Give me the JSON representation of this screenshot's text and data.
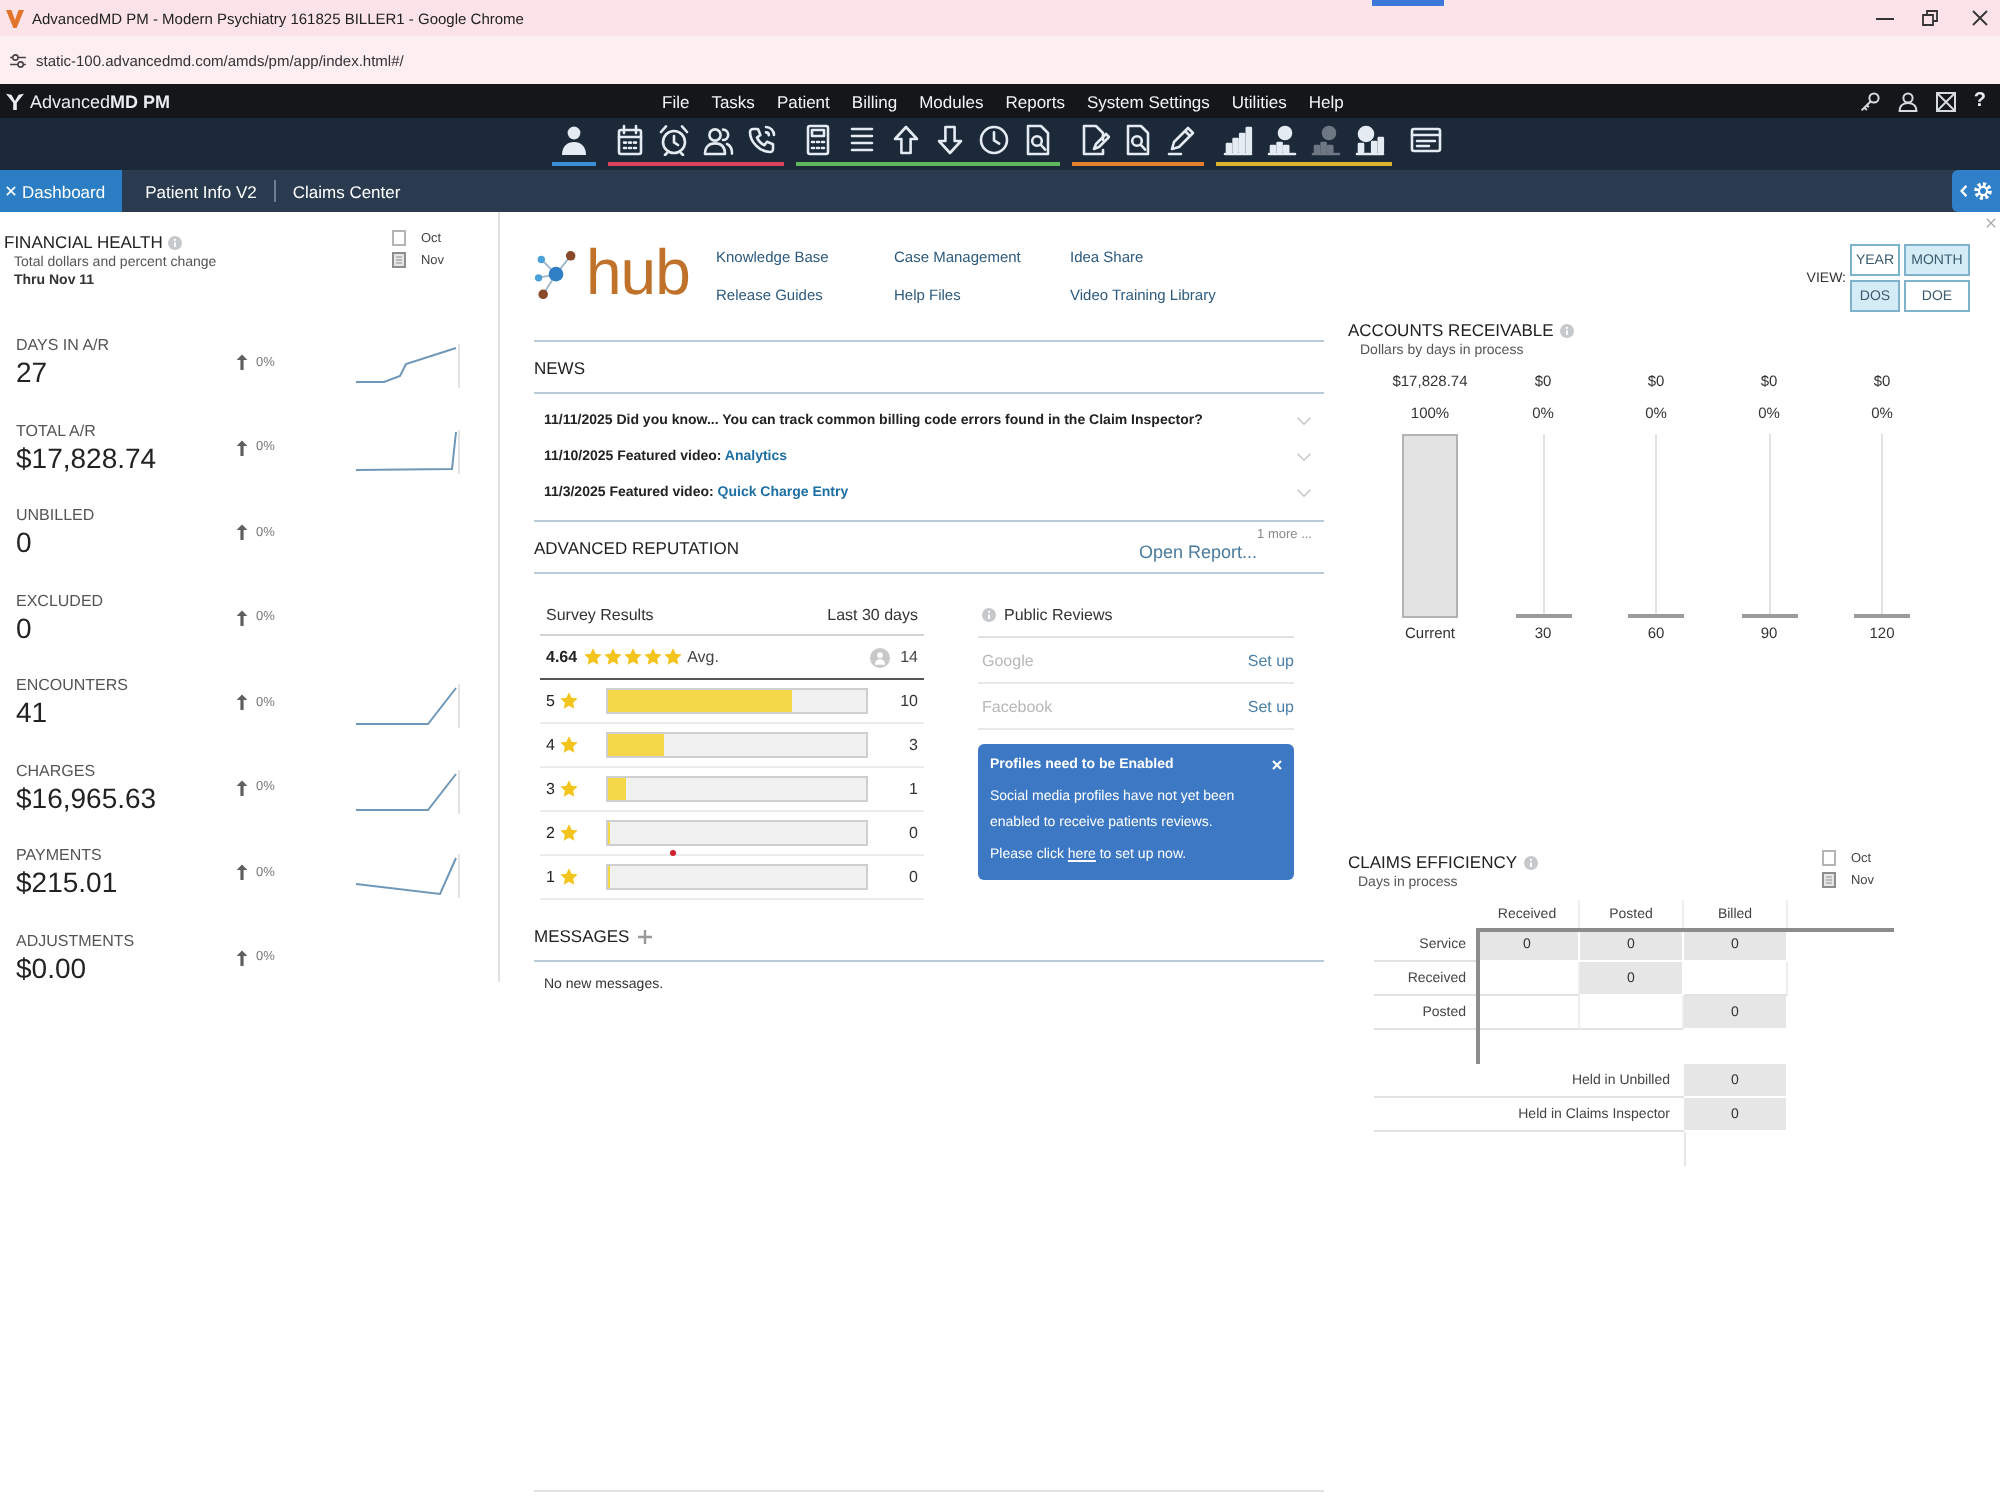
{
  "browser": {
    "title": "AdvancedMD PM - Modern Psychiatry 161825 BILLER1 - Google Chrome",
    "url": "static-100.advancedmd.com/amds/pm/app/index.html#/"
  },
  "app_header": {
    "logo": "Advanced**MD PM**",
    "menu": [
      "File",
      "Tasks",
      "Patient",
      "Billing",
      "Modules",
      "Reports",
      "System Settings",
      "Utilities",
      "Help"
    ],
    "help": "?"
  },
  "toolbar": {
    "groups": [
      {
        "color": "#3b8fd4",
        "icons": [
          {
            "disabled": false
          }
        ]
      },
      {
        "color": "#d8435b",
        "icons": [
          {
            "disabled": false
          },
          {
            "disabled": false
          },
          {
            "disabled": false
          },
          {
            "disabled": false
          }
        ]
      },
      {
        "color": "#5cb85a",
        "icons": [
          {
            "disabled": false
          },
          {
            "disabled": false
          },
          {
            "disabled": false
          },
          {
            "disabled": false
          },
          {
            "disabled": false
          },
          {
            "disabled": false
          }
        ]
      },
      {
        "color": "#e5802c",
        "icons": [
          {
            "disabled": false
          },
          {
            "disabled": false
          },
          {
            "disabled": false
          }
        ]
      },
      {
        "color": "#dcb52e",
        "icons": [
          {
            "disabled": false
          },
          {
            "disabled": false
          },
          {
            "disabled": true
          },
          {
            "disabled": false
          }
        ]
      },
      {
        "icons": [
          {
            "disabled": false
          }
        ]
      }
    ]
  },
  "tabs": [
    {
      "label": "Dashboard",
      "selected": true,
      "closable": true
    },
    {
      "label": "Patient Info V2",
      "selected": false,
      "closable": false
    },
    {
      "label": "Claims Center",
      "selected": false,
      "closable": false
    }
  ],
  "financial_health": {
    "title": "FINANCIAL HEALTH",
    "subtitle": "Total dollars and percent change",
    "period": "Thru Nov 11",
    "legend": [
      {
        "label": "Oct",
        "kind": "outline"
      },
      {
        "label": "Nov",
        "kind": "hatched"
      }
    ],
    "metrics": [
      {
        "label": "DAYS IN A/R",
        "value": "27",
        "rising": true,
        "change": "0%",
        "kind": "step"
      },
      {
        "label": "TOTAL A/R",
        "value": "$17,828.74",
        "rising": true,
        "change": "0%",
        "kind": "spike"
      },
      {
        "label": "UNBILLED",
        "value": "0",
        "rising": true,
        "change": "0%",
        "kind": "plain"
      },
      {
        "label": "EXCLUDED",
        "value": "0",
        "rising": true,
        "change": "0%",
        "kind": "plain"
      },
      {
        "label": "ENCOUNTERS",
        "value": "41",
        "rising": true,
        "change": "0%",
        "kind": "ramp"
      },
      {
        "label": "CHARGES",
        "value": "$16,965.63",
        "rising": true,
        "change": "0%",
        "kind": "ramp"
      },
      {
        "label": "PAYMENTS",
        "value": "$215.01",
        "rising": true,
        "change": "0%",
        "kind": "dip"
      },
      {
        "label": "ADJUSTMENTS",
        "value": "$0.00",
        "rising": true,
        "change": "0%",
        "kind": "plain"
      }
    ]
  },
  "hub": {
    "logo": "hub",
    "links": [
      "Knowledge Base",
      "Case Management",
      "Idea Share",
      "Release Guides",
      "Help Files",
      "Video Training Library"
    ]
  },
  "news": {
    "title": "NEWS",
    "items": [
      {
        "text": "11/11/2025 Did you know... You can track common billing code errors found in the Claim Inspector?",
        "expanded": false
      },
      {
        "text": "11/10/2025 Featured video:",
        "link": "Analytics",
        "expanded": false
      },
      {
        "text": "11/3/2025 Featured video:",
        "link": "Quick Charge Entry",
        "expanded": false
      }
    ]
  },
  "reputation": {
    "title": "ADVANCED REPUTATION",
    "open_report": "Open Report...",
    "more": "1 more ...",
    "survey": {
      "title": "Survey Results",
      "period": "Last 30 days",
      "average": "4.64",
      "stars": 5,
      "average_label": "Avg.",
      "total": "14",
      "ratings": [
        {
          "label": "5",
          "count": "10",
          "level": 0.714
        },
        {
          "label": "4",
          "count": "3",
          "level": 0.214
        },
        {
          "label": "3",
          "count": "1",
          "level": 0.071
        },
        {
          "label": "2",
          "count": "0",
          "level": 0
        },
        {
          "label": "1",
          "count": "0",
          "level": 0
        }
      ]
    },
    "public_reviews": {
      "title": "Public Reviews",
      "sites": [
        {
          "name": "Google",
          "action": "Set up",
          "connected": false
        },
        {
          "name": "Facebook",
          "action": "Set up",
          "connected": false
        }
      ],
      "notice": {
        "title": "Profiles need to be Enabled",
        "body": "Social media profiles have not yet been enabled to receive patients reviews.",
        "prompt_before": "Please click",
        "prompt_link": "here",
        "prompt_after": "to set up now."
      }
    }
  },
  "messages": {
    "title": "MESSAGES",
    "empty": "No new messages."
  },
  "view": {
    "label": "VIEW:",
    "rows": [
      {
        "options": [
          {
            "label": "YEAR",
            "selected": false
          },
          {
            "label": "MONTH",
            "selected": true
          }
        ]
      },
      {
        "options": [
          {
            "label": "DOS",
            "selected": true
          },
          {
            "label": "DOE",
            "selected": false
          }
        ]
      }
    ]
  },
  "accounts_receivable": {
    "title": "ACCOUNTS RECEIVABLE",
    "subtitle": "Dollars by days in process",
    "columns": [
      {
        "amount": "$17,828.74",
        "percent": "100%",
        "level": 1,
        "label": "Current"
      },
      {
        "amount": "$0",
        "percent": "0%",
        "level": 0,
        "label": "30"
      },
      {
        "amount": "$0",
        "percent": "0%",
        "level": 0,
        "label": "60"
      },
      {
        "amount": "$0",
        "percent": "0%",
        "level": 0,
        "label": "90"
      },
      {
        "amount": "$0",
        "percent": "0%",
        "level": 0,
        "label": "120"
      }
    ]
  },
  "claims_efficiency": {
    "title": "CLAIMS EFFICIENCY",
    "subtitle": "Days in process",
    "legend": [
      {
        "label": "Oct",
        "kind": "outline"
      },
      {
        "label": "Nov",
        "kind": "hatched"
      }
    ],
    "columns": [
      "Received",
      "Posted",
      "Billed"
    ],
    "rows": [
      {
        "label": "Service",
        "cells": [
          "0",
          "0",
          "0"
        ]
      },
      {
        "label": "Received",
        "cells": [
          null,
          "0",
          null
        ]
      },
      {
        "label": "Posted",
        "cells": [
          null,
          null,
          "0"
        ]
      }
    ],
    "held": [
      {
        "label": "Held in Unbilled",
        "value": "0"
      },
      {
        "label": "Held in Claims Inspector",
        "value": "0"
      }
    ]
  }
}
